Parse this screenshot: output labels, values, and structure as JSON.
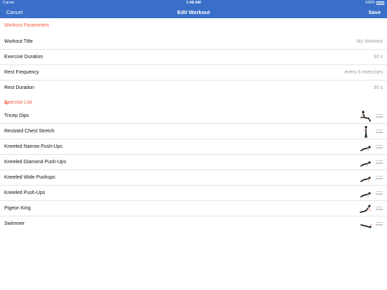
{
  "status_bar": {
    "carrier": "Carrier",
    "time": "1:48 AM",
    "battery": "100%"
  },
  "nav": {
    "cancel": "Cancel",
    "title": "Edit Workout",
    "save": "Save"
  },
  "parameters": {
    "header": "Workout Parameters",
    "rows": [
      {
        "label": "Workout Title",
        "value": "My Workout"
      },
      {
        "label": "Exercise Duration",
        "value": "30 s"
      },
      {
        "label": "Rest Frequency",
        "value": "every 6 exercises"
      },
      {
        "label": "Rest Duration",
        "value": "30 s"
      }
    ]
  },
  "exercise_list": {
    "header": "Exercise List",
    "add_icon": "plus-icon",
    "items": [
      {
        "label": "Tricep Dips",
        "icon": "tricep-dips-figure"
      },
      {
        "label": "Resisted Chest Stretch",
        "icon": "standing-figure"
      },
      {
        "label": "Kneeled Narrow Push-Ups",
        "icon": "pushup-figure"
      },
      {
        "label": "Kneeled Diamond Push-Ups",
        "icon": "pushup-figure"
      },
      {
        "label": "Kneeled Wide Pushups",
        "icon": "pushup-figure"
      },
      {
        "label": "Kneeled Push-Ups",
        "icon": "pushup-figure"
      },
      {
        "label": "Pigeon King",
        "icon": "stretch-figure"
      },
      {
        "label": "Swimmer",
        "icon": "lying-figure"
      }
    ]
  },
  "colors": {
    "nav_blue": "#3a6fc9",
    "accent_orange": "#f25d3c",
    "value_gray": "#9b9b9b"
  }
}
